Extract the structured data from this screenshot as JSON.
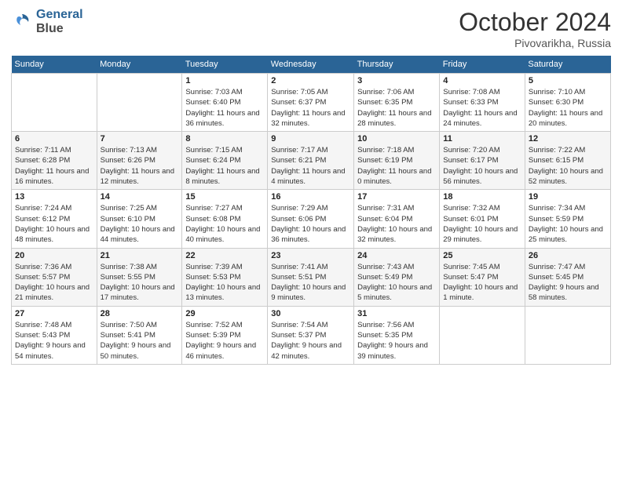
{
  "header": {
    "logo_line1": "General",
    "logo_line2": "Blue",
    "month_title": "October 2024",
    "location": "Pivovarikha, Russia"
  },
  "days_of_week": [
    "Sunday",
    "Monday",
    "Tuesday",
    "Wednesday",
    "Thursday",
    "Friday",
    "Saturday"
  ],
  "weeks": [
    [
      null,
      null,
      {
        "day": "1",
        "sunrise": "Sunrise: 7:03 AM",
        "sunset": "Sunset: 6:40 PM",
        "daylight": "Daylight: 11 hours and 36 minutes."
      },
      {
        "day": "2",
        "sunrise": "Sunrise: 7:05 AM",
        "sunset": "Sunset: 6:37 PM",
        "daylight": "Daylight: 11 hours and 32 minutes."
      },
      {
        "day": "3",
        "sunrise": "Sunrise: 7:06 AM",
        "sunset": "Sunset: 6:35 PM",
        "daylight": "Daylight: 11 hours and 28 minutes."
      },
      {
        "day": "4",
        "sunrise": "Sunrise: 7:08 AM",
        "sunset": "Sunset: 6:33 PM",
        "daylight": "Daylight: 11 hours and 24 minutes."
      },
      {
        "day": "5",
        "sunrise": "Sunrise: 7:10 AM",
        "sunset": "Sunset: 6:30 PM",
        "daylight": "Daylight: 11 hours and 20 minutes."
      }
    ],
    [
      {
        "day": "6",
        "sunrise": "Sunrise: 7:11 AM",
        "sunset": "Sunset: 6:28 PM",
        "daylight": "Daylight: 11 hours and 16 minutes."
      },
      {
        "day": "7",
        "sunrise": "Sunrise: 7:13 AM",
        "sunset": "Sunset: 6:26 PM",
        "daylight": "Daylight: 11 hours and 12 minutes."
      },
      {
        "day": "8",
        "sunrise": "Sunrise: 7:15 AM",
        "sunset": "Sunset: 6:24 PM",
        "daylight": "Daylight: 11 hours and 8 minutes."
      },
      {
        "day": "9",
        "sunrise": "Sunrise: 7:17 AM",
        "sunset": "Sunset: 6:21 PM",
        "daylight": "Daylight: 11 hours and 4 minutes."
      },
      {
        "day": "10",
        "sunrise": "Sunrise: 7:18 AM",
        "sunset": "Sunset: 6:19 PM",
        "daylight": "Daylight: 11 hours and 0 minutes."
      },
      {
        "day": "11",
        "sunrise": "Sunrise: 7:20 AM",
        "sunset": "Sunset: 6:17 PM",
        "daylight": "Daylight: 10 hours and 56 minutes."
      },
      {
        "day": "12",
        "sunrise": "Sunrise: 7:22 AM",
        "sunset": "Sunset: 6:15 PM",
        "daylight": "Daylight: 10 hours and 52 minutes."
      }
    ],
    [
      {
        "day": "13",
        "sunrise": "Sunrise: 7:24 AM",
        "sunset": "Sunset: 6:12 PM",
        "daylight": "Daylight: 10 hours and 48 minutes."
      },
      {
        "day": "14",
        "sunrise": "Sunrise: 7:25 AM",
        "sunset": "Sunset: 6:10 PM",
        "daylight": "Daylight: 10 hours and 44 minutes."
      },
      {
        "day": "15",
        "sunrise": "Sunrise: 7:27 AM",
        "sunset": "Sunset: 6:08 PM",
        "daylight": "Daylight: 10 hours and 40 minutes."
      },
      {
        "day": "16",
        "sunrise": "Sunrise: 7:29 AM",
        "sunset": "Sunset: 6:06 PM",
        "daylight": "Daylight: 10 hours and 36 minutes."
      },
      {
        "day": "17",
        "sunrise": "Sunrise: 7:31 AM",
        "sunset": "Sunset: 6:04 PM",
        "daylight": "Daylight: 10 hours and 32 minutes."
      },
      {
        "day": "18",
        "sunrise": "Sunrise: 7:32 AM",
        "sunset": "Sunset: 6:01 PM",
        "daylight": "Daylight: 10 hours and 29 minutes."
      },
      {
        "day": "19",
        "sunrise": "Sunrise: 7:34 AM",
        "sunset": "Sunset: 5:59 PM",
        "daylight": "Daylight: 10 hours and 25 minutes."
      }
    ],
    [
      {
        "day": "20",
        "sunrise": "Sunrise: 7:36 AM",
        "sunset": "Sunset: 5:57 PM",
        "daylight": "Daylight: 10 hours and 21 minutes."
      },
      {
        "day": "21",
        "sunrise": "Sunrise: 7:38 AM",
        "sunset": "Sunset: 5:55 PM",
        "daylight": "Daylight: 10 hours and 17 minutes."
      },
      {
        "day": "22",
        "sunrise": "Sunrise: 7:39 AM",
        "sunset": "Sunset: 5:53 PM",
        "daylight": "Daylight: 10 hours and 13 minutes."
      },
      {
        "day": "23",
        "sunrise": "Sunrise: 7:41 AM",
        "sunset": "Sunset: 5:51 PM",
        "daylight": "Daylight: 10 hours and 9 minutes."
      },
      {
        "day": "24",
        "sunrise": "Sunrise: 7:43 AM",
        "sunset": "Sunset: 5:49 PM",
        "daylight": "Daylight: 10 hours and 5 minutes."
      },
      {
        "day": "25",
        "sunrise": "Sunrise: 7:45 AM",
        "sunset": "Sunset: 5:47 PM",
        "daylight": "Daylight: 10 hours and 1 minute."
      },
      {
        "day": "26",
        "sunrise": "Sunrise: 7:47 AM",
        "sunset": "Sunset: 5:45 PM",
        "daylight": "Daylight: 9 hours and 58 minutes."
      }
    ],
    [
      {
        "day": "27",
        "sunrise": "Sunrise: 7:48 AM",
        "sunset": "Sunset: 5:43 PM",
        "daylight": "Daylight: 9 hours and 54 minutes."
      },
      {
        "day": "28",
        "sunrise": "Sunrise: 7:50 AM",
        "sunset": "Sunset: 5:41 PM",
        "daylight": "Daylight: 9 hours and 50 minutes."
      },
      {
        "day": "29",
        "sunrise": "Sunrise: 7:52 AM",
        "sunset": "Sunset: 5:39 PM",
        "daylight": "Daylight: 9 hours and 46 minutes."
      },
      {
        "day": "30",
        "sunrise": "Sunrise: 7:54 AM",
        "sunset": "Sunset: 5:37 PM",
        "daylight": "Daylight: 9 hours and 42 minutes."
      },
      {
        "day": "31",
        "sunrise": "Sunrise: 7:56 AM",
        "sunset": "Sunset: 5:35 PM",
        "daylight": "Daylight: 9 hours and 39 minutes."
      },
      null,
      null
    ]
  ]
}
